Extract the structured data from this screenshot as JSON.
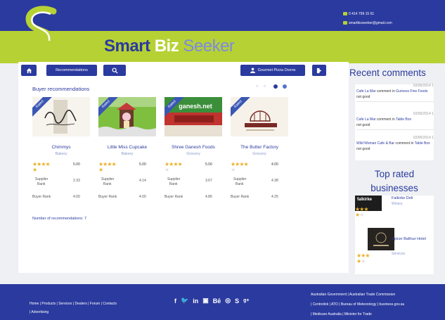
{
  "header": {
    "brand": {
      "word1": "Smart",
      "word2": "Biz",
      "word3": "Seeker"
    },
    "phone": "0 414 799 15 61",
    "email": "smartbizseeker@gmail.com"
  },
  "nav": {
    "recommendations_label": "Recommendations",
    "gourmet_label": "Gourmet Pizza Ovens"
  },
  "section": {
    "title": "Buyer recommendations",
    "count_label": "Number of recommendations: 7"
  },
  "cards": [
    {
      "badge": "Rated",
      "name": "Chimmys",
      "category": "Bakery",
      "rating": "5.00",
      "stars_full": 5,
      "supplier_label": "Supplier\nRank",
      "supplier_value": "2.33",
      "buyer_label": "Buyer Rank",
      "buyer_value": "4.00"
    },
    {
      "badge": "Rated",
      "name": "Little Miss Cupcake",
      "category": "Bakery",
      "rating": "5.00",
      "stars_full": 5,
      "supplier_label": "Supplier\nRank",
      "supplier_value": "4.14",
      "buyer_label": "Buyer Rank",
      "buyer_value": "4.00"
    },
    {
      "badge": "Rated",
      "name": "Shree Ganesh Foods",
      "category": "Grocery",
      "rating": "5.00",
      "stars_full": 4,
      "supplier_label": "Supplier\nRank",
      "supplier_value": "3.67",
      "buyer_label": "Buyer Rank",
      "buyer_value": "4.86"
    },
    {
      "badge": "Rated",
      "name": "The Butter Factory",
      "category": "Grocery",
      "rating": "4.00",
      "stars_full": 4,
      "supplier_label": "Supplier\nRank",
      "supplier_value": "4.38",
      "buyer_label": "Buyer Rank",
      "buyer_value": "4.25"
    }
  ],
  "recent_comments": {
    "title": "Recent comments",
    "items": [
      {
        "date": "02/06/2014 1",
        "who": "Cafe La Mar",
        "verb": "comment",
        "on": "Gurness Fine Foods",
        "msg": "not good"
      },
      {
        "date": "02/06/2014 1",
        "who": "Cafe La Mar",
        "verb": "comment",
        "on": "Table Box",
        "msg": "not good"
      },
      {
        "date": "02/06/2014 1",
        "who": "Wild Woman Cafe & Bar",
        "verb": "comment",
        "on": "Table Box",
        "msg": "not good"
      }
    ]
  },
  "top_rated": {
    "title": "Top rated businesses",
    "items": [
      {
        "name": "Falkirke Deli",
        "category": "Winery"
      },
      {
        "name": "Spicer Balfour Hotel",
        "category": "Services"
      }
    ]
  },
  "footer": {
    "links": "Home | Products | Services | Dealers | Forum | Contacts",
    "links2": "| Advertising",
    "right1": "Australian Government | Australian Trade Commission",
    "right2": "| Centrelink | ATO | Bureau of Meteorology | business.gov.au",
    "right3": "| Medicare Australia | Minister for Trade"
  }
}
